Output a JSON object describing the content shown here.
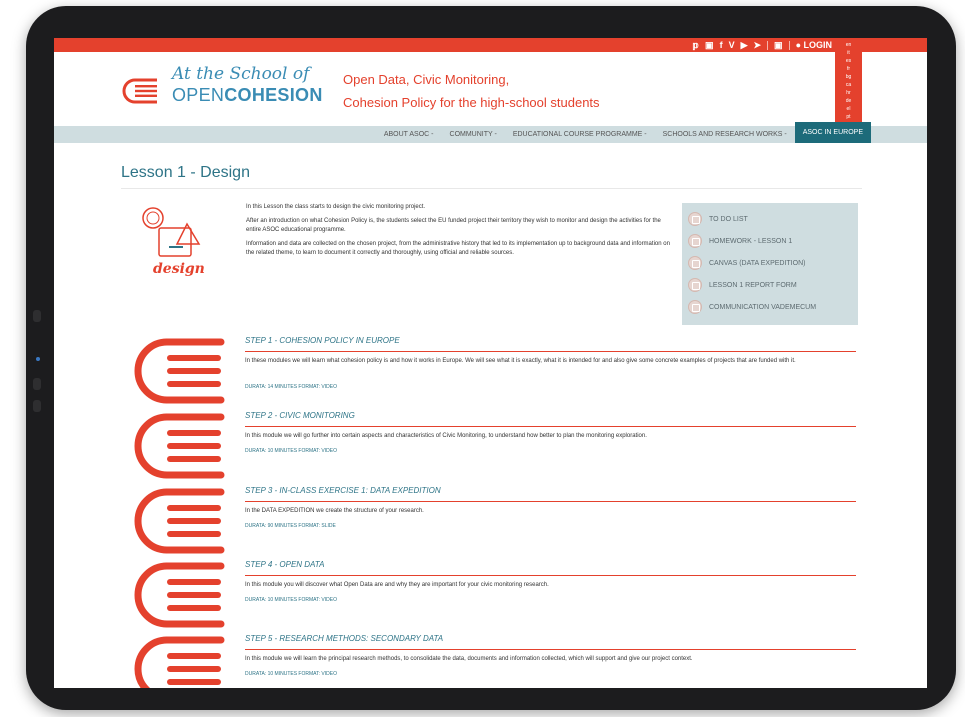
{
  "header": {
    "logo_line1": "At the School of",
    "logo_line2_a": "OPEN",
    "logo_line2_b": "COHESION",
    "tagline_1": "Open Data, Civic Monitoring,",
    "tagline_2": "Cohesion Policy for the high-school students",
    "login_label": "LOGIN",
    "social_icons": [
      "twitter-icon",
      "instagram-icon",
      "facebook-icon",
      "vimeo-icon",
      "youtube-icon",
      "telegram-icon",
      "rss-icon"
    ],
    "languages": [
      "en",
      "it",
      "es",
      "fr",
      "bg",
      "ca",
      "hr",
      "de",
      "el",
      "pt"
    ]
  },
  "nav": {
    "items": [
      {
        "label": "ABOUT ASOC -"
      },
      {
        "label": "COMMUNITY -"
      },
      {
        "label": "EDUCATIONAL COURSE PROGRAMME -"
      },
      {
        "label": "SCHOOLS AND RESEARCH WORKS -"
      },
      {
        "label": "ASOC IN EUROPE"
      }
    ]
  },
  "lesson": {
    "title": "Lesson 1 - Design",
    "icon_label": "design",
    "intro": [
      "In this Lesson the class starts to design the civic monitoring project.",
      "After an introduction on what Cohesion Policy is, the students select the EU funded project their territory they wish to monitor and design the activities for the entire ASOC educational programme.",
      "Information and data are collected on the chosen project, from the administrative history that led to its implementation up to background data and information on the related theme, to learn to document it correctly and thoroughly, using official and reliable sources."
    ]
  },
  "todo": {
    "items": [
      {
        "label": "TO DO LIST"
      },
      {
        "label": "HOMEWORK - LESSON 1"
      },
      {
        "label": "CANVAS (DATA EXPEDITION)"
      },
      {
        "label": "LESSON 1 REPORT FORM"
      },
      {
        "label": "COMMUNICATION VADEMECUM"
      }
    ]
  },
  "steps": [
    {
      "title": "STEP 1 - COHESION POLICY IN EUROPE",
      "desc": "In these modules we will learn what cohesion policy is and how it works in Europe. We will see what it is exactly, what it is intended for and also give some concrete examples of projects that are funded with it.",
      "meta": "DURATA: 14 MINUTES FORMAT: VIDEO"
    },
    {
      "title": "STEP 2 - CIVIC MONITORING",
      "desc": "In this module we will go further into certain aspects and characteristics of Civic Monitoring, to understand how better to plan the monitoring exploration.",
      "meta": "DURATA: 10 MINUTES FORMAT: VIDEO"
    },
    {
      "title": "STEP 3 - IN-CLASS EXERCISE 1: DATA EXPEDITION",
      "desc": "In the DATA EXPEDITION we create the structure of your research.",
      "meta": "DURATA: 90 MINUTES FORMAT: SLIDE"
    },
    {
      "title": "STEP 4 - OPEN DATA",
      "desc": "In this module you will discover what Open Data are and why they are important for your civic monitoring research.",
      "meta": "DURATA: 10 MINUTES FORMAT: VIDEO"
    },
    {
      "title": "STEP 5 - RESEARCH METHODS: SECONDARY DATA",
      "desc": "In this module we will learn the principal research methods, to consolidate the data, documents and information collected, which will support and give our project context.",
      "meta": "DURATA: 10 MINUTES FORMAT: VIDEO"
    }
  ],
  "colors": {
    "accent": "#e4412d",
    "teal": "#2e7487",
    "nav_bg": "#cfdde0",
    "nav_active": "#1d6b7a"
  }
}
